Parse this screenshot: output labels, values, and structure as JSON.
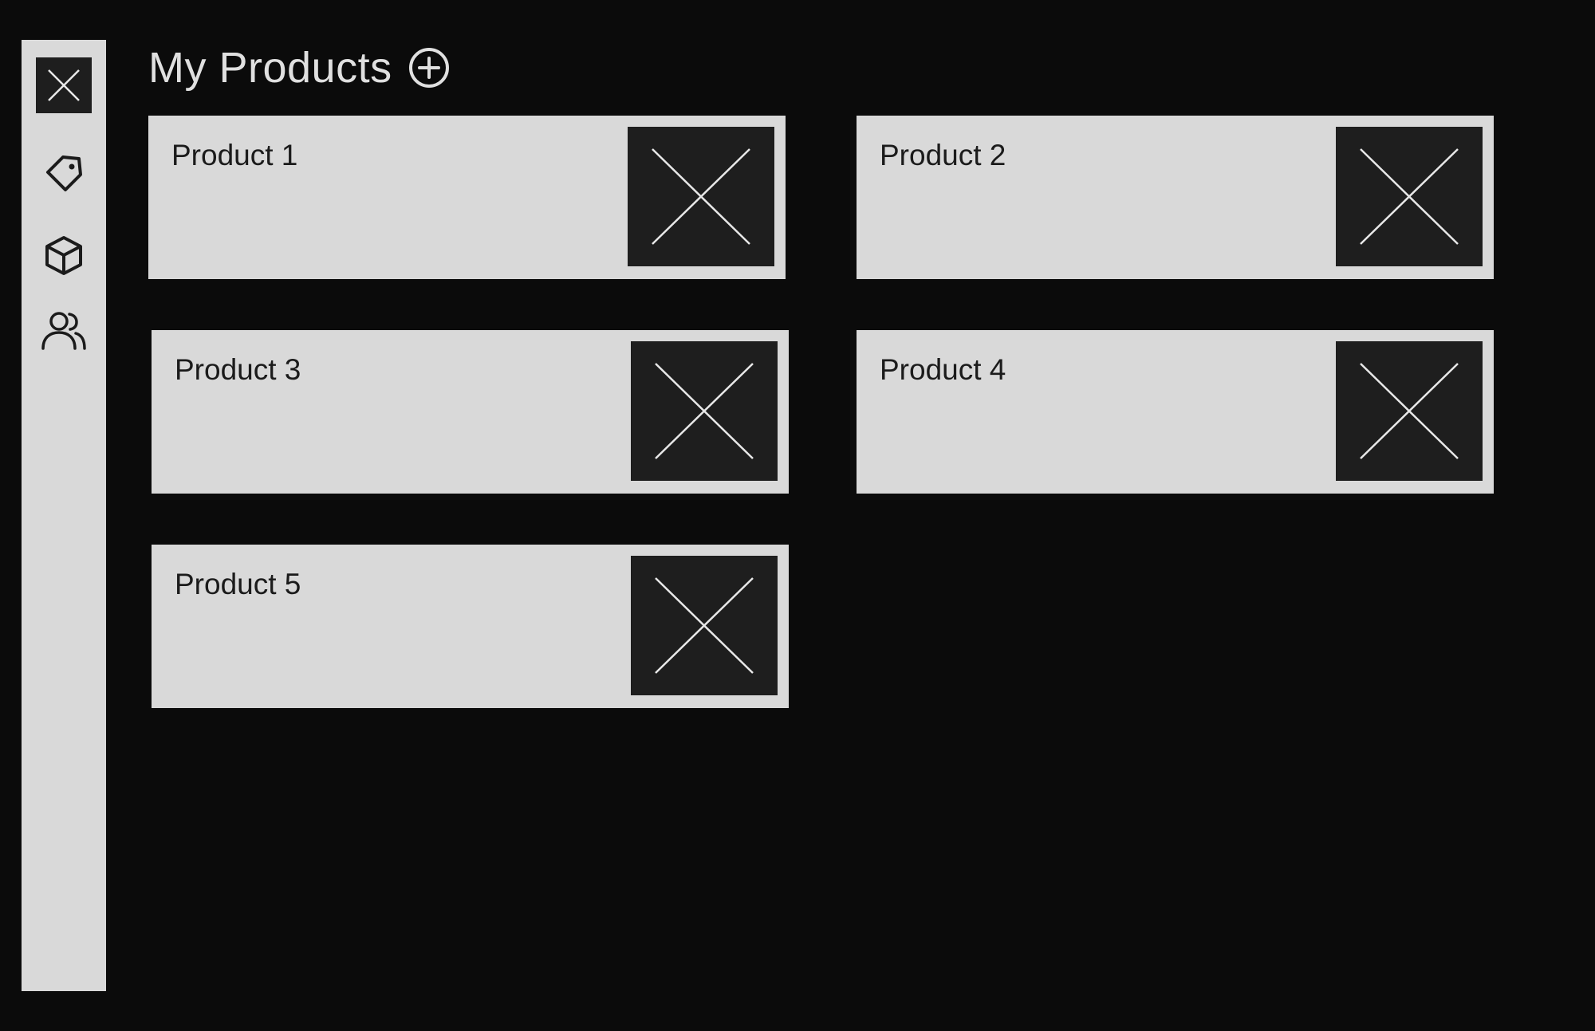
{
  "header": {
    "title": "My Products",
    "add_icon": "plus-circle-icon"
  },
  "sidebar": {
    "items": [
      {
        "icon": "close-icon"
      },
      {
        "icon": "tag-icon"
      },
      {
        "icon": "box-icon"
      },
      {
        "icon": "users-icon"
      }
    ]
  },
  "products": [
    {
      "name": "Product 1",
      "image_icon": "image-placeholder-icon"
    },
    {
      "name": "Product 2",
      "image_icon": "image-placeholder-icon"
    },
    {
      "name": "Product 3",
      "image_icon": "image-placeholder-icon"
    },
    {
      "name": "Product 4",
      "image_icon": "image-placeholder-icon"
    },
    {
      "name": "Product 5",
      "image_icon": "image-placeholder-icon"
    }
  ],
  "colors": {
    "background": "#0b0b0b",
    "panel": "#d9d9d9",
    "thumb": "#1e1e1e",
    "title_text": "#e0e0e0"
  }
}
